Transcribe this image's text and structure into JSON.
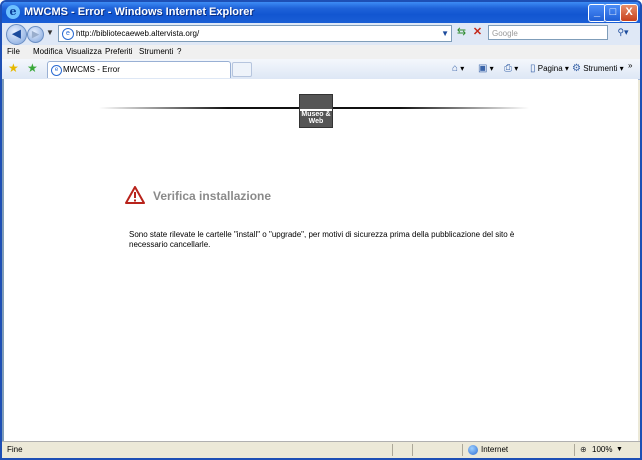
{
  "window": {
    "title": "MWCMS - Error - Windows Internet Explorer",
    "app_icon": "ie-logo-icon",
    "buttons": {
      "minimize": "_",
      "maximize": "□",
      "close": "X"
    }
  },
  "address_bar": {
    "url": "http://bibliotecaeweb.altervista.org/",
    "search_placeholder": "Google"
  },
  "menu": {
    "items": [
      "File",
      "Modifica",
      "Visualizza",
      "Preferiti",
      "Strumenti",
      "?"
    ]
  },
  "tabs": [
    {
      "label": "MWCMS - Error",
      "icon": "ie-page-icon"
    }
  ],
  "command_bar": {
    "page_label": "Pagina",
    "tools_label": "Strumenti"
  },
  "content": {
    "logo_text": "Museo & Web",
    "heading": "Verifica installazione",
    "message": "Sono state rilevate le cartelle \"install\" o \"upgrade\", per motivi di sicurezza prima della pubblicazione del sito è necessario cancellarle.",
    "warning_color": "#b8231b"
  },
  "status_bar": {
    "text": "Fine",
    "zone": "Internet",
    "zoom": "100%"
  }
}
